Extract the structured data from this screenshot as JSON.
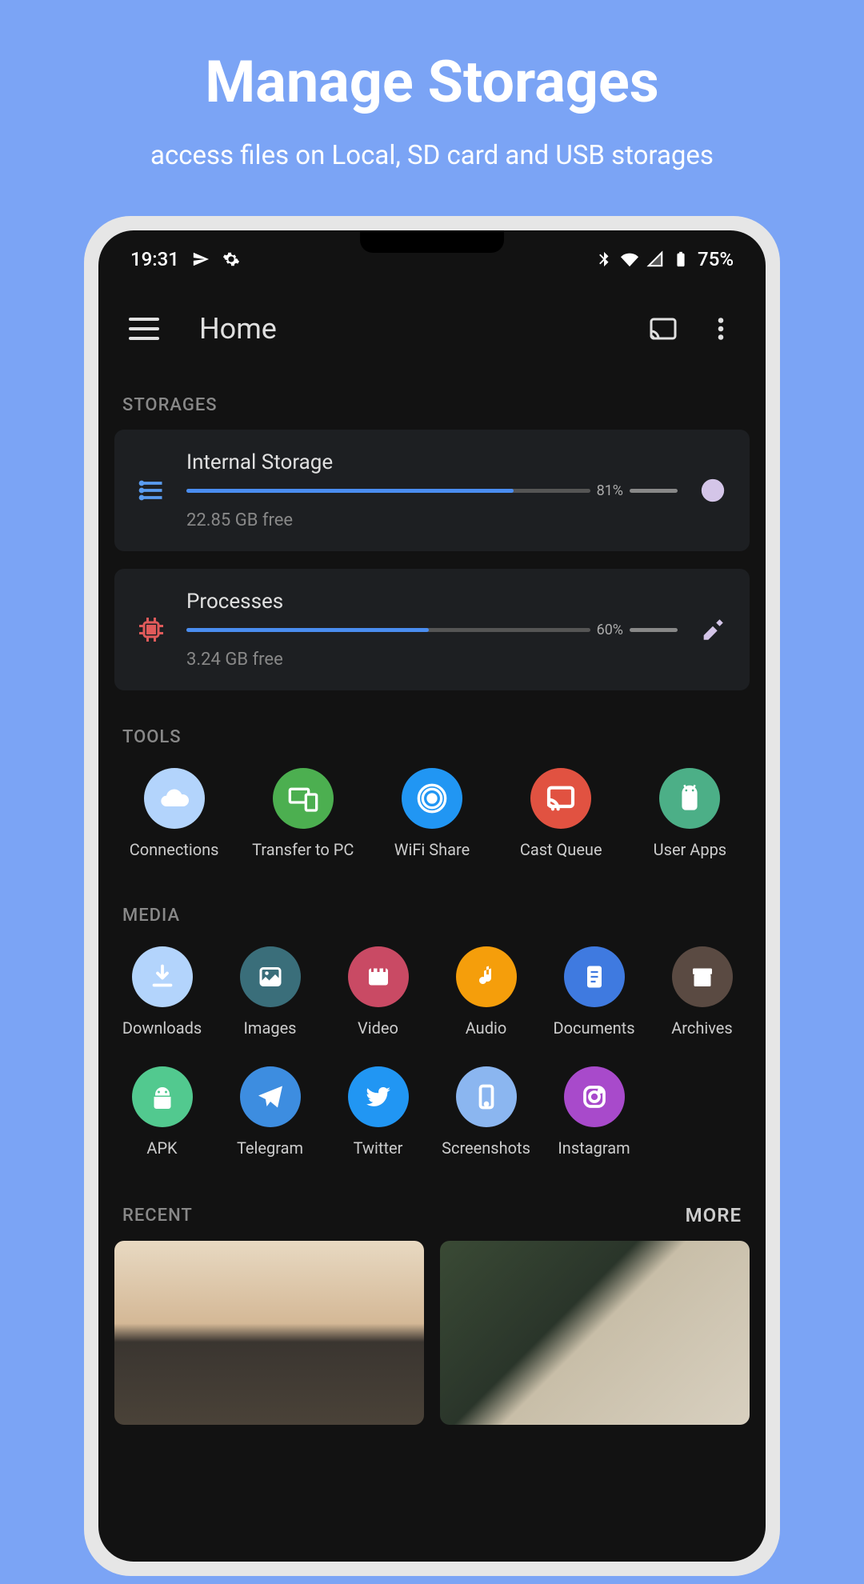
{
  "promo": {
    "title": "Manage Storages",
    "subtitle": "access files on Local, SD card and USB storages"
  },
  "status": {
    "time": "19:31",
    "battery": "75%"
  },
  "appbar": {
    "title": "Home"
  },
  "sections": {
    "storages": "STORAGES",
    "tools": "TOOLS",
    "media": "MEDIA",
    "recent": "RECENT",
    "more": "MORE"
  },
  "storages": [
    {
      "title": "Internal Storage",
      "percent": 81,
      "percentLabel": "81%",
      "free": "22.85 GB free"
    },
    {
      "title": "Processes",
      "percent": 60,
      "percentLabel": "60%",
      "free": "3.24 GB free"
    }
  ],
  "tools": [
    {
      "label": "Connections"
    },
    {
      "label": "Transfer to PC"
    },
    {
      "label": "WiFi Share"
    },
    {
      "label": "Cast Queue"
    },
    {
      "label": "User Apps"
    }
  ],
  "media": [
    {
      "label": "Downloads"
    },
    {
      "label": "Images"
    },
    {
      "label": "Video"
    },
    {
      "label": "Audio"
    },
    {
      "label": "Documents"
    },
    {
      "label": "Archives"
    },
    {
      "label": "APK"
    },
    {
      "label": "Telegram"
    },
    {
      "label": "Twitter"
    },
    {
      "label": "Screenshots"
    },
    {
      "label": "Instagram"
    }
  ]
}
